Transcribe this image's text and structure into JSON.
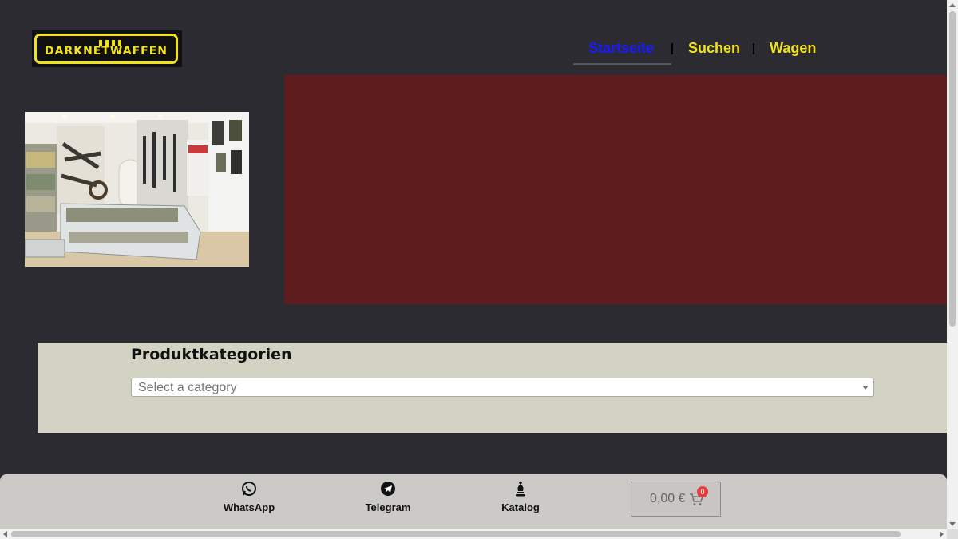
{
  "header": {
    "logo_text": "DARKNETWAFFEN",
    "nav": [
      {
        "label": "Startseite",
        "active": true,
        "color": "#1a1aff"
      },
      {
        "label": "Suchen",
        "active": false,
        "color": "#f2e21c"
      },
      {
        "label": "Wagen",
        "active": false,
        "color": "#f2e21c"
      }
    ]
  },
  "hero": {
    "image_subject": "weapon shop interior with display cases",
    "block_color": "#5e1c1f"
  },
  "categories": {
    "title": "Produktkategorien",
    "select_placeholder": "Select a category"
  },
  "bottom_bar": {
    "items": [
      {
        "label": "WhatsApp",
        "icon": "whatsapp-icon"
      },
      {
        "label": "Telegram",
        "icon": "telegram-icon"
      },
      {
        "label": "Katalog",
        "icon": "chess-bishop-icon"
      }
    ],
    "cart": {
      "amount": "0,00 €",
      "count": "0",
      "icon": "cart-icon"
    }
  },
  "colors": {
    "page_bg": "#2b2b31",
    "brand_yellow": "#f2e21c",
    "panel_bg": "#d3d3c3",
    "bottom_bar_bg": "#cbcac6",
    "badge_red": "#e53c3c"
  }
}
